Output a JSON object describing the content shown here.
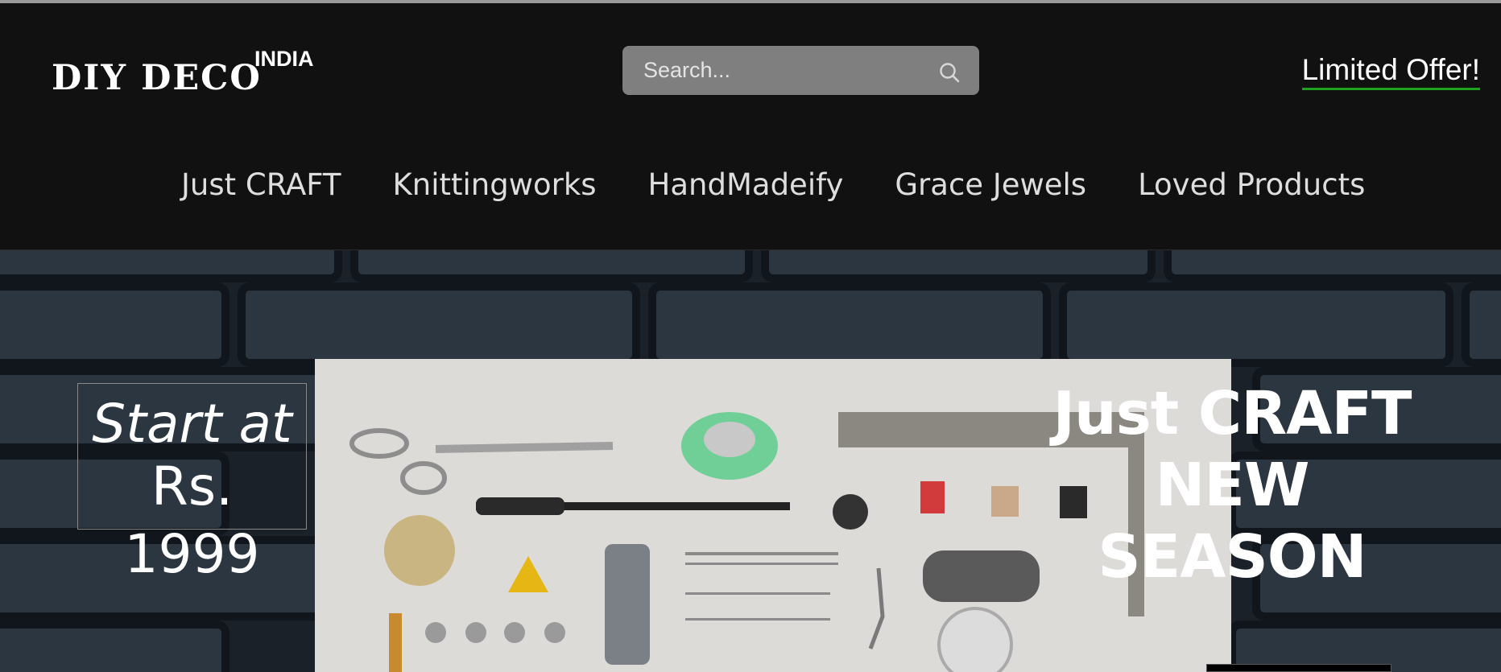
{
  "header": {
    "logo_main": "DIY DECO",
    "logo_superscript": "INDIA",
    "search_placeholder": "Search...",
    "offer_label": "Limited Offer!"
  },
  "nav": {
    "items": [
      {
        "label": "Just CRAFT"
      },
      {
        "label": "Knittingworks"
      },
      {
        "label": "HandMadeify"
      },
      {
        "label": "Grace Jewels"
      },
      {
        "label": "Loved Products"
      }
    ]
  },
  "hero": {
    "price_line1": "Start at",
    "price_line2": "Rs. 1999",
    "headline_line1": "Just CRAFT",
    "headline_line2": "NEW",
    "headline_line3": "SEASON"
  },
  "colors": {
    "header_bg": "#111111",
    "search_bg": "#7f7f7f",
    "offer_underline": "#1fa31f",
    "wall": "#1b232a",
    "photo_bg": "#dcdad6"
  },
  "icons": {
    "search": "search-icon"
  }
}
